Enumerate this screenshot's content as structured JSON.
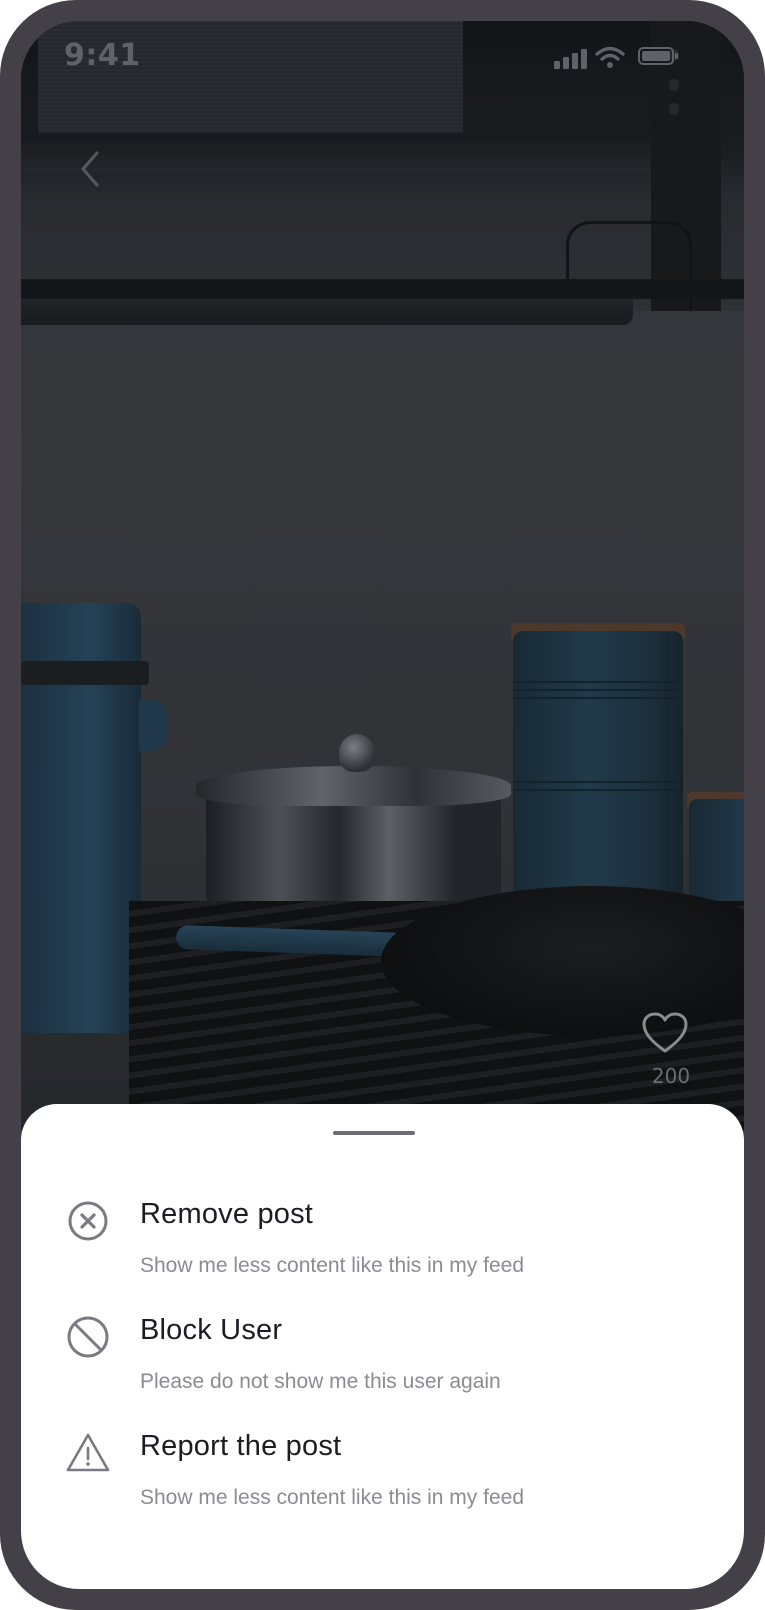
{
  "status_bar": {
    "time": "9:41",
    "icons": [
      "cellular-signal-icon",
      "wifi-icon",
      "battery-icon"
    ]
  },
  "navigation": {
    "back_icon": "chevron-left-icon"
  },
  "post": {
    "like_icon": "heart-icon",
    "like_count": "200"
  },
  "sheet": {
    "options": [
      {
        "icon": "close-circle-icon",
        "title": "Remove post",
        "subtitle": "Show me less content like this in my feed"
      },
      {
        "icon": "block-icon",
        "title": "Block User",
        "subtitle": "Please do not show me this user again"
      },
      {
        "icon": "warning-triangle-icon",
        "title": "Report the post",
        "subtitle": "Show me less content like this in my feed"
      }
    ]
  },
  "colors": {
    "device_frame": "#434047",
    "sheet_background": "#ffffff",
    "title_text": "#1c1c22",
    "subtitle_text": "#8b8b93",
    "icon_stroke": "#7a7a82",
    "grabber": "#6b6b73"
  }
}
